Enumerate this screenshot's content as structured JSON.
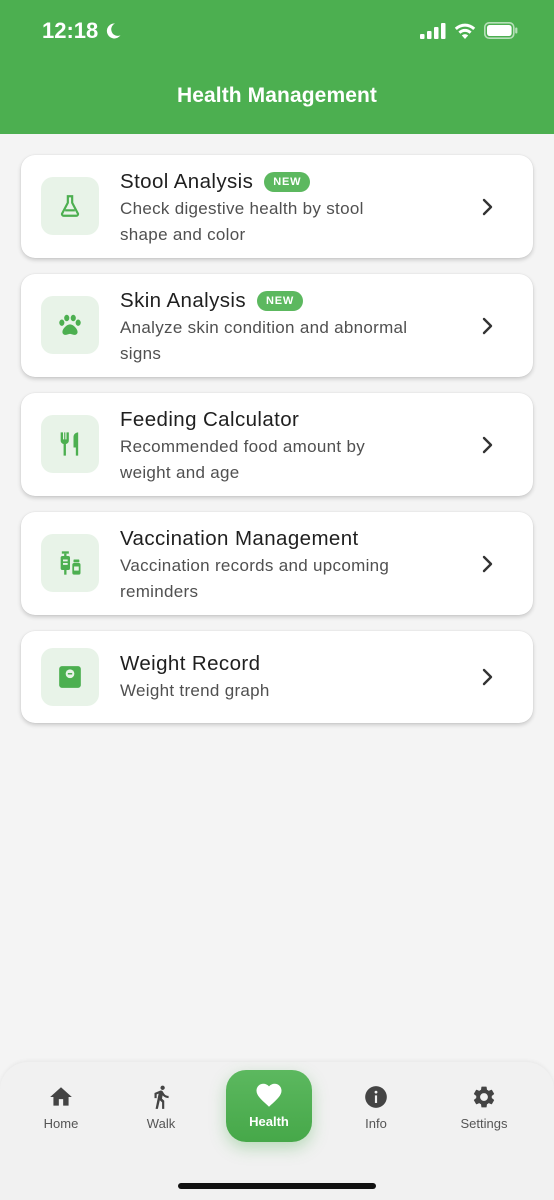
{
  "status_bar": {
    "time": "12:18"
  },
  "header": {
    "title": "Health Management"
  },
  "items": [
    {
      "name": "Stool Analysis",
      "badge": "NEW",
      "desc1": "Check digestive health by stool",
      "desc2": "shape and color",
      "icon": "flask-icon"
    },
    {
      "name": "Skin Analysis",
      "badge": "NEW",
      "desc1": "Analyze skin condition and abnormal",
      "desc2": "signs",
      "icon": "paw-icon"
    },
    {
      "name": "Feeding Calculator",
      "desc1": "Recommended food amount by",
      "desc2": "weight and age",
      "icon": "fork-knife-icon"
    },
    {
      "name": "Vaccination Management",
      "desc1": "Vaccination records and upcoming",
      "desc2": "reminders",
      "icon": "vaccine-icon"
    },
    {
      "name": "Weight Record",
      "desc1": "Weight trend graph",
      "icon": "scale-icon"
    }
  ],
  "nav": [
    {
      "label": "Home",
      "icon": "home-icon"
    },
    {
      "label": "Walk",
      "icon": "walk-icon"
    },
    {
      "label": "Health",
      "icon": "heart-icon",
      "active": true
    },
    {
      "label": "Info",
      "icon": "info-icon"
    },
    {
      "label": "Settings",
      "icon": "gear-icon"
    }
  ],
  "colors": {
    "primary": "#4caf50",
    "icon_bg": "#e8f3e8",
    "background": "#f4f4f4"
  }
}
